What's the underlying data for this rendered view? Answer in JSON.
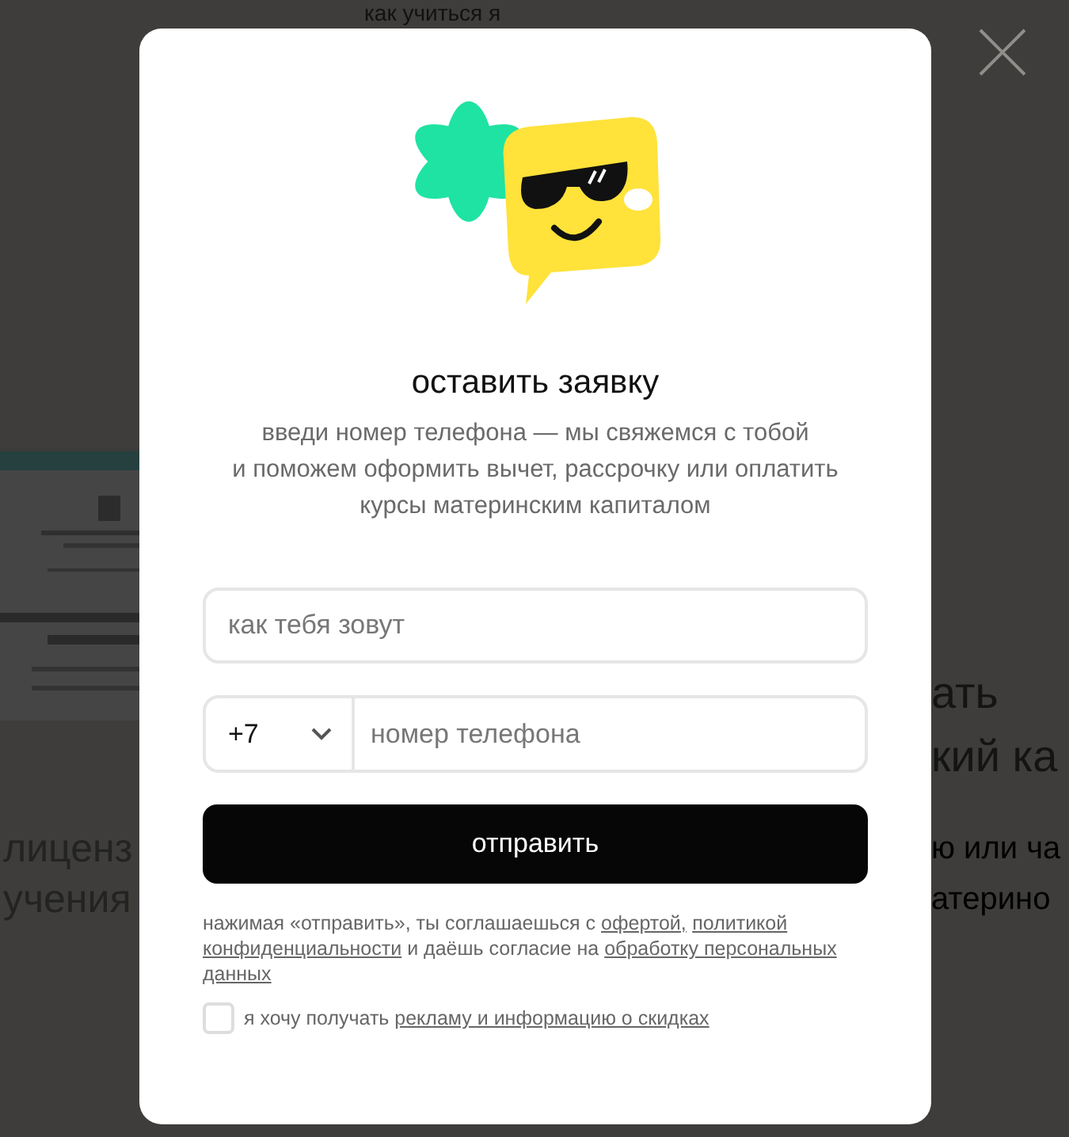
{
  "background": {
    "heading": "как учиться я",
    "document": {
      "kind": "picture"
    },
    "left_lines": [
      "лиценз",
      "учения"
    ],
    "right_heading": [
      "ать",
      "кий ка"
    ],
    "right_lines": [
      "ю или ча",
      "атерино"
    ]
  },
  "modal": {
    "title": "оставить заявку",
    "subtitle": [
      "введи номер телефона — мы свяжемся с тобой",
      "и поможем оформить вычет, рассрочку или оплатить",
      "курсы материнским капиталом"
    ],
    "name_field": {
      "placeholder": "как тебя зовут"
    },
    "phone_field": {
      "country_code": "+7",
      "placeholder": "номер телефона"
    },
    "submit": "отправить",
    "consent": [
      [
        {
          "kind": "text",
          "text": "нажимая «отправить», ты соглашаешься с "
        },
        {
          "kind": "link",
          "text": "офертой,"
        },
        {
          "kind": "link",
          "text": "политикой"
        }
      ],
      [
        {
          "kind": "link",
          "text": "конфиденциальности"
        },
        {
          "kind": "text",
          "text": " и даёшь согласие на "
        },
        {
          "kind": "link",
          "text": "обработку персональных"
        }
      ],
      [
        {
          "kind": "link",
          "text": "данных"
        }
      ]
    ],
    "ads_checkbox": {
      "checked": false,
      "parts": [
        {
          "kind": "text",
          "text": "я хочу получать "
        },
        {
          "kind": "link",
          "text": "рекламу и информацию о скидках"
        }
      ]
    }
  }
}
